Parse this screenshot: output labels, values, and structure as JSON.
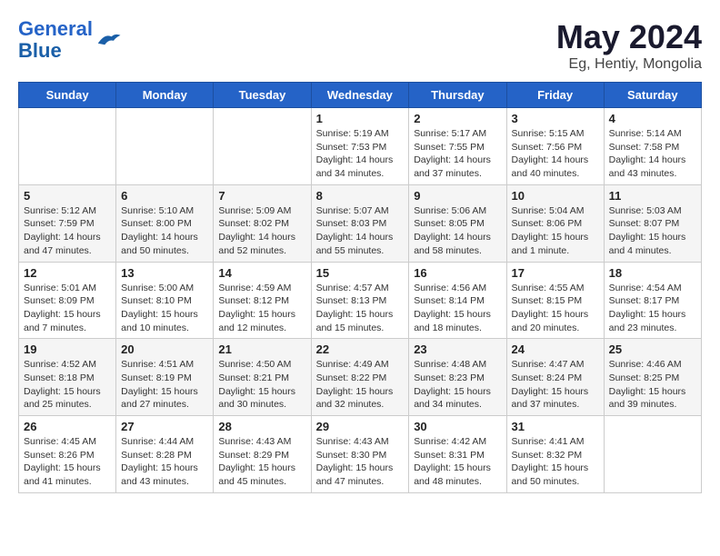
{
  "logo": {
    "line1": "General",
    "line2": "Blue"
  },
  "title": "May 2024",
  "subtitle": "Eg, Hentiy, Mongolia",
  "weekdays": [
    "Sunday",
    "Monday",
    "Tuesday",
    "Wednesday",
    "Thursday",
    "Friday",
    "Saturday"
  ],
  "weeks": [
    [
      {
        "day": "",
        "sunrise": "",
        "sunset": "",
        "daylight": ""
      },
      {
        "day": "",
        "sunrise": "",
        "sunset": "",
        "daylight": ""
      },
      {
        "day": "",
        "sunrise": "",
        "sunset": "",
        "daylight": ""
      },
      {
        "day": "1",
        "sunrise": "Sunrise: 5:19 AM",
        "sunset": "Sunset: 7:53 PM",
        "daylight": "Daylight: 14 hours and 34 minutes."
      },
      {
        "day": "2",
        "sunrise": "Sunrise: 5:17 AM",
        "sunset": "Sunset: 7:55 PM",
        "daylight": "Daylight: 14 hours and 37 minutes."
      },
      {
        "day": "3",
        "sunrise": "Sunrise: 5:15 AM",
        "sunset": "Sunset: 7:56 PM",
        "daylight": "Daylight: 14 hours and 40 minutes."
      },
      {
        "day": "4",
        "sunrise": "Sunrise: 5:14 AM",
        "sunset": "Sunset: 7:58 PM",
        "daylight": "Daylight: 14 hours and 43 minutes."
      }
    ],
    [
      {
        "day": "5",
        "sunrise": "Sunrise: 5:12 AM",
        "sunset": "Sunset: 7:59 PM",
        "daylight": "Daylight: 14 hours and 47 minutes."
      },
      {
        "day": "6",
        "sunrise": "Sunrise: 5:10 AM",
        "sunset": "Sunset: 8:00 PM",
        "daylight": "Daylight: 14 hours and 50 minutes."
      },
      {
        "day": "7",
        "sunrise": "Sunrise: 5:09 AM",
        "sunset": "Sunset: 8:02 PM",
        "daylight": "Daylight: 14 hours and 52 minutes."
      },
      {
        "day": "8",
        "sunrise": "Sunrise: 5:07 AM",
        "sunset": "Sunset: 8:03 PM",
        "daylight": "Daylight: 14 hours and 55 minutes."
      },
      {
        "day": "9",
        "sunrise": "Sunrise: 5:06 AM",
        "sunset": "Sunset: 8:05 PM",
        "daylight": "Daylight: 14 hours and 58 minutes."
      },
      {
        "day": "10",
        "sunrise": "Sunrise: 5:04 AM",
        "sunset": "Sunset: 8:06 PM",
        "daylight": "Daylight: 15 hours and 1 minute."
      },
      {
        "day": "11",
        "sunrise": "Sunrise: 5:03 AM",
        "sunset": "Sunset: 8:07 PM",
        "daylight": "Daylight: 15 hours and 4 minutes."
      }
    ],
    [
      {
        "day": "12",
        "sunrise": "Sunrise: 5:01 AM",
        "sunset": "Sunset: 8:09 PM",
        "daylight": "Daylight: 15 hours and 7 minutes."
      },
      {
        "day": "13",
        "sunrise": "Sunrise: 5:00 AM",
        "sunset": "Sunset: 8:10 PM",
        "daylight": "Daylight: 15 hours and 10 minutes."
      },
      {
        "day": "14",
        "sunrise": "Sunrise: 4:59 AM",
        "sunset": "Sunset: 8:12 PM",
        "daylight": "Daylight: 15 hours and 12 minutes."
      },
      {
        "day": "15",
        "sunrise": "Sunrise: 4:57 AM",
        "sunset": "Sunset: 8:13 PM",
        "daylight": "Daylight: 15 hours and 15 minutes."
      },
      {
        "day": "16",
        "sunrise": "Sunrise: 4:56 AM",
        "sunset": "Sunset: 8:14 PM",
        "daylight": "Daylight: 15 hours and 18 minutes."
      },
      {
        "day": "17",
        "sunrise": "Sunrise: 4:55 AM",
        "sunset": "Sunset: 8:15 PM",
        "daylight": "Daylight: 15 hours and 20 minutes."
      },
      {
        "day": "18",
        "sunrise": "Sunrise: 4:54 AM",
        "sunset": "Sunset: 8:17 PM",
        "daylight": "Daylight: 15 hours and 23 minutes."
      }
    ],
    [
      {
        "day": "19",
        "sunrise": "Sunrise: 4:52 AM",
        "sunset": "Sunset: 8:18 PM",
        "daylight": "Daylight: 15 hours and 25 minutes."
      },
      {
        "day": "20",
        "sunrise": "Sunrise: 4:51 AM",
        "sunset": "Sunset: 8:19 PM",
        "daylight": "Daylight: 15 hours and 27 minutes."
      },
      {
        "day": "21",
        "sunrise": "Sunrise: 4:50 AM",
        "sunset": "Sunset: 8:21 PM",
        "daylight": "Daylight: 15 hours and 30 minutes."
      },
      {
        "day": "22",
        "sunrise": "Sunrise: 4:49 AM",
        "sunset": "Sunset: 8:22 PM",
        "daylight": "Daylight: 15 hours and 32 minutes."
      },
      {
        "day": "23",
        "sunrise": "Sunrise: 4:48 AM",
        "sunset": "Sunset: 8:23 PM",
        "daylight": "Daylight: 15 hours and 34 minutes."
      },
      {
        "day": "24",
        "sunrise": "Sunrise: 4:47 AM",
        "sunset": "Sunset: 8:24 PM",
        "daylight": "Daylight: 15 hours and 37 minutes."
      },
      {
        "day": "25",
        "sunrise": "Sunrise: 4:46 AM",
        "sunset": "Sunset: 8:25 PM",
        "daylight": "Daylight: 15 hours and 39 minutes."
      }
    ],
    [
      {
        "day": "26",
        "sunrise": "Sunrise: 4:45 AM",
        "sunset": "Sunset: 8:26 PM",
        "daylight": "Daylight: 15 hours and 41 minutes."
      },
      {
        "day": "27",
        "sunrise": "Sunrise: 4:44 AM",
        "sunset": "Sunset: 8:28 PM",
        "daylight": "Daylight: 15 hours and 43 minutes."
      },
      {
        "day": "28",
        "sunrise": "Sunrise: 4:43 AM",
        "sunset": "Sunset: 8:29 PM",
        "daylight": "Daylight: 15 hours and 45 minutes."
      },
      {
        "day": "29",
        "sunrise": "Sunrise: 4:43 AM",
        "sunset": "Sunset: 8:30 PM",
        "daylight": "Daylight: 15 hours and 47 minutes."
      },
      {
        "day": "30",
        "sunrise": "Sunrise: 4:42 AM",
        "sunset": "Sunset: 8:31 PM",
        "daylight": "Daylight: 15 hours and 48 minutes."
      },
      {
        "day": "31",
        "sunrise": "Sunrise: 4:41 AM",
        "sunset": "Sunset: 8:32 PM",
        "daylight": "Daylight: 15 hours and 50 minutes."
      },
      {
        "day": "",
        "sunrise": "",
        "sunset": "",
        "daylight": ""
      }
    ]
  ]
}
